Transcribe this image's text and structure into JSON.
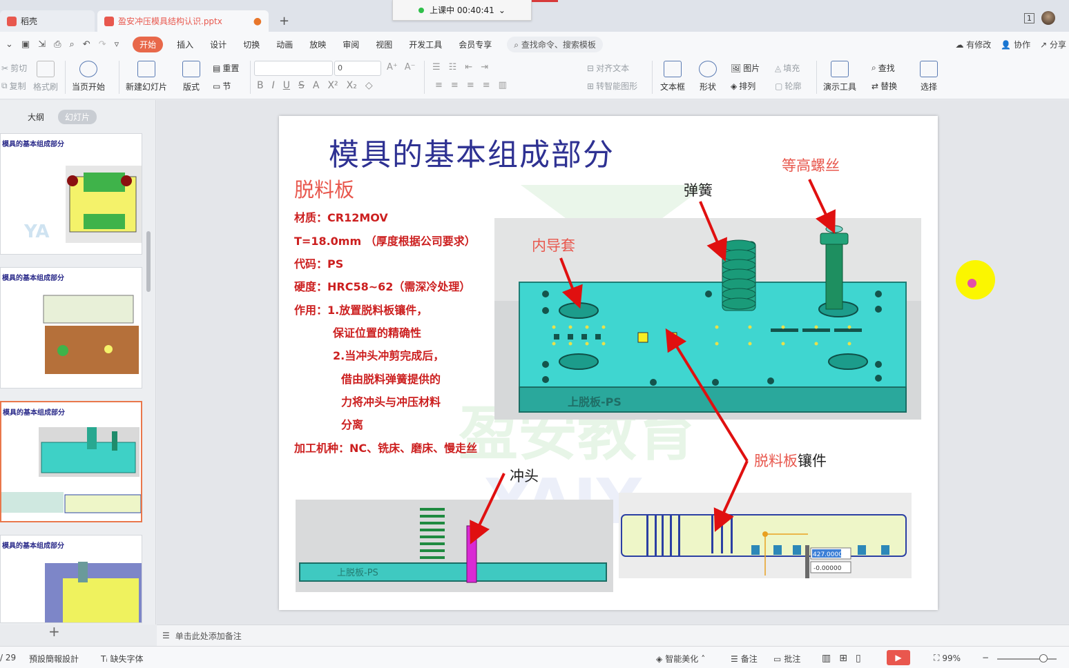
{
  "tabs": [
    {
      "label": "稻壳",
      "icon": "docer-icon",
      "color": "#e8584e"
    },
    {
      "label": "盈安冲压模具结构认识.pptx",
      "icon": "ppt-icon",
      "color": "#e8584e"
    }
  ],
  "timer": {
    "label": "上课中 00:40:41"
  },
  "top_right": {
    "window_count": "1"
  },
  "menu": {
    "items": [
      "开始",
      "插入",
      "设计",
      "切换",
      "动画",
      "放映",
      "审阅",
      "视图",
      "开发工具",
      "会员专享"
    ],
    "active": "开始",
    "search": "查找命令、搜索模板",
    "collab": [
      "有修改",
      "协作",
      "分享"
    ]
  },
  "ribbon": {
    "cut": "剪切",
    "copy": "复制",
    "format_painter": "格式刷",
    "play_from_current": "当页开始",
    "new_slide": "新建幻灯片",
    "layout": "版式",
    "reset": "重置",
    "section": "节",
    "font_size": "0",
    "align_text": "对齐文本",
    "smart_art": "转智能图形",
    "textbox": "文本框",
    "shape": "形状",
    "picture": "图片",
    "arrange": "排列",
    "fill": "填充",
    "outline": "轮廓",
    "presentation_tools": "演示工具",
    "find": "查找",
    "replace": "替换",
    "select": "选择"
  },
  "left_panel": {
    "tab_outline": "大纲",
    "tab_slides": "幻灯片",
    "thumb_title": "模具的基本组成部分"
  },
  "slide": {
    "title": "模具的基本组成部分",
    "subtitle": "脱料板",
    "specs": [
      "材质：CR12MOV",
      "T=18.0mm （厚度根据公司要求）",
      "代码：PS",
      "硬度：HRC58~62（需深冷处理）",
      "作用：1.放置脱料板镶件，",
      "保证位置的精确性",
      "2.当冲头冲剪完成后，",
      "借由脱料弹簧提供的",
      "力将冲头与冲压材料",
      "分离",
      "加工机种：NC、铣床、磨床、慢走丝"
    ],
    "labels": {
      "spring": "弹簧",
      "bolt": "等高螺丝",
      "inner_guide": "内导套",
      "insert_part1": "脱料板",
      "insert_part2": "镶件",
      "punch": "冲头"
    },
    "plate_label": "上脱板-PS",
    "plate_label_bottom": "上脱板-PS",
    "coord_x": "427.0000",
    "coord_y": "-0.00000"
  },
  "notes": {
    "placeholder": "单击此处添加备注"
  },
  "status": {
    "page": "/ 29",
    "theme": "預設簡報設計",
    "missing_font": "缺失字体",
    "beautify": "智能美化",
    "notes": "备注",
    "comments": "批注",
    "zoom": "99%"
  }
}
